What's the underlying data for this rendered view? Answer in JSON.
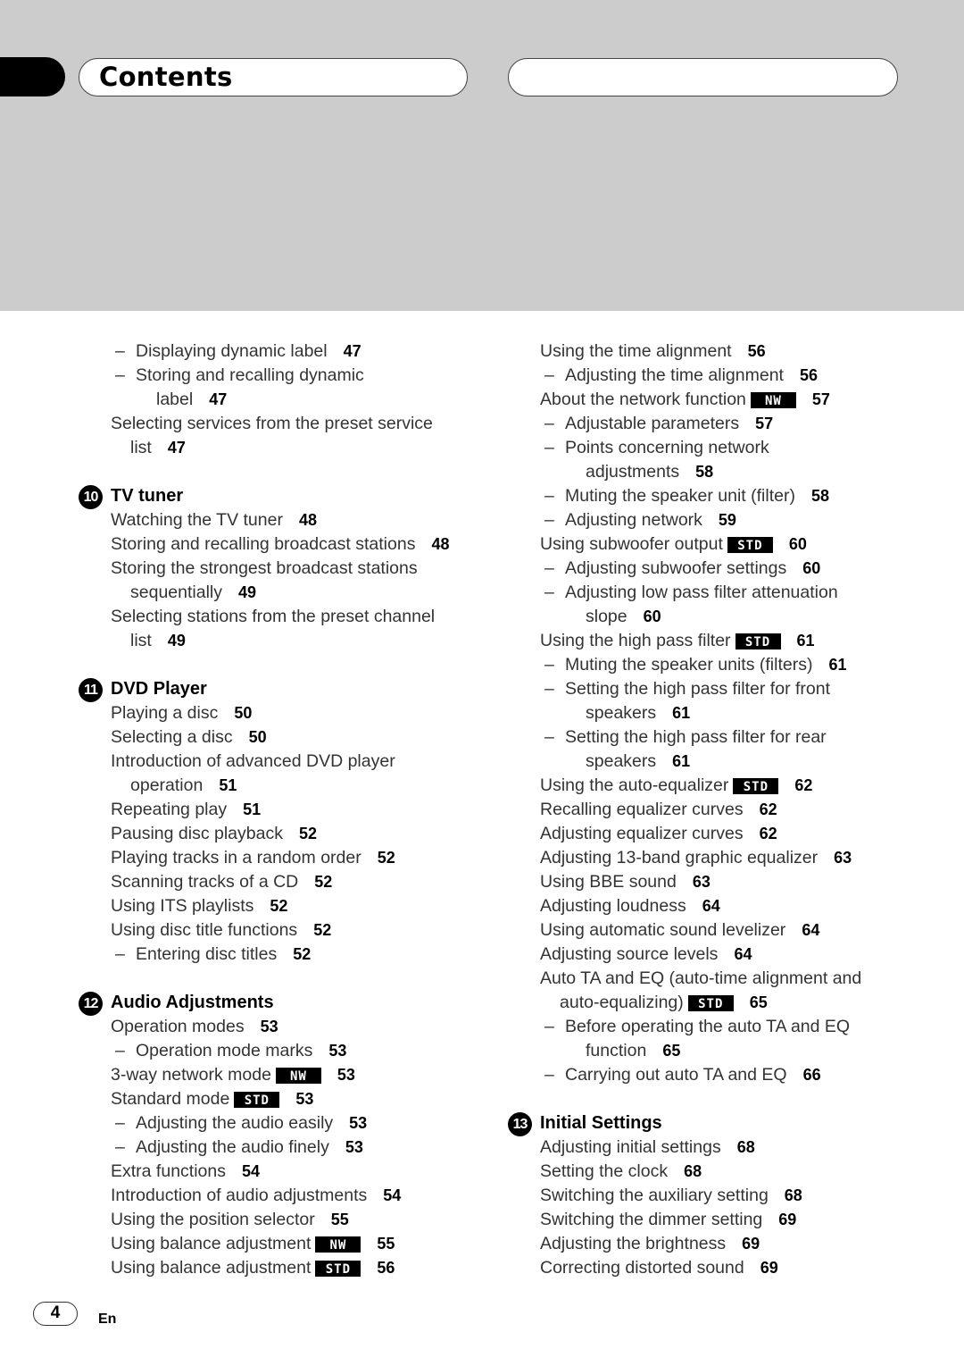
{
  "header": {
    "title": "Contents"
  },
  "left_column": [
    {
      "type": "entry",
      "level": 1,
      "text": "Displaying dynamic label",
      "page": "47"
    },
    {
      "type": "entry",
      "level": 1,
      "text": "Storing and recalling dynamic",
      "page": null
    },
    {
      "type": "cont",
      "level": 1,
      "text": "label",
      "page": "47"
    },
    {
      "type": "entry",
      "level": 0,
      "text": "Selecting services from the preset service",
      "page": null
    },
    {
      "type": "cont",
      "level": 0,
      "text": "list",
      "page": "47"
    },
    {
      "type": "section",
      "number": "10",
      "text": "TV tuner"
    },
    {
      "type": "entry",
      "level": 0,
      "text": "Watching the TV tuner",
      "page": "48"
    },
    {
      "type": "entry",
      "level": 0,
      "text": "Storing and recalling broadcast stations",
      "page": "48"
    },
    {
      "type": "entry",
      "level": 0,
      "text": "Storing the strongest broadcast stations",
      "page": null
    },
    {
      "type": "cont",
      "level": 0,
      "text": "sequentially",
      "page": "49"
    },
    {
      "type": "entry",
      "level": 0,
      "text": "Selecting stations from the preset channel",
      "page": null
    },
    {
      "type": "cont",
      "level": 0,
      "text": "list",
      "page": "49"
    },
    {
      "type": "section",
      "number": "11",
      "text": "DVD Player"
    },
    {
      "type": "entry",
      "level": 0,
      "text": "Playing a disc",
      "page": "50"
    },
    {
      "type": "entry",
      "level": 0,
      "text": "Selecting a disc",
      "page": "50"
    },
    {
      "type": "entry",
      "level": 0,
      "text": "Introduction of advanced DVD player",
      "page": null
    },
    {
      "type": "cont",
      "level": 0,
      "text": "operation",
      "page": "51"
    },
    {
      "type": "entry",
      "level": 0,
      "text": "Repeating play",
      "page": "51"
    },
    {
      "type": "entry",
      "level": 0,
      "text": "Pausing disc playback",
      "page": "52"
    },
    {
      "type": "entry",
      "level": 0,
      "text": "Playing tracks in a random order",
      "page": "52"
    },
    {
      "type": "entry",
      "level": 0,
      "text": "Scanning tracks of a CD",
      "page": "52"
    },
    {
      "type": "entry",
      "level": 0,
      "text": "Using ITS playlists",
      "page": "52"
    },
    {
      "type": "entry",
      "level": 0,
      "text": "Using disc title functions",
      "page": "52"
    },
    {
      "type": "entry",
      "level": 1,
      "text": "Entering disc titles",
      "page": "52"
    },
    {
      "type": "section",
      "number": "12",
      "text": "Audio Adjustments"
    },
    {
      "type": "entry",
      "level": 0,
      "text": "Operation modes",
      "page": "53"
    },
    {
      "type": "entry",
      "level": 1,
      "text": "Operation mode marks",
      "page": "53"
    },
    {
      "type": "entry",
      "level": 0,
      "text": "3-way network mode",
      "badge": "NW",
      "page": "53"
    },
    {
      "type": "entry",
      "level": 0,
      "text": "Standard mode",
      "badge": "STD",
      "page": "53"
    },
    {
      "type": "entry",
      "level": 1,
      "text": "Adjusting the audio easily",
      "page": "53"
    },
    {
      "type": "entry",
      "level": 1,
      "text": "Adjusting the audio finely",
      "page": "53"
    },
    {
      "type": "entry",
      "level": 0,
      "text": "Extra functions",
      "page": "54"
    },
    {
      "type": "entry",
      "level": 0,
      "text": "Introduction of audio adjustments",
      "page": "54"
    },
    {
      "type": "entry",
      "level": 0,
      "text": "Using the position selector",
      "page": "55"
    },
    {
      "type": "entry",
      "level": 0,
      "text": "Using balance adjustment",
      "badge": "NW",
      "page": "55"
    },
    {
      "type": "entry",
      "level": 0,
      "text": "Using balance adjustment",
      "badge": "STD",
      "page": "56"
    }
  ],
  "right_column": [
    {
      "type": "entry",
      "level": 0,
      "text": "Using the time alignment",
      "page": "56"
    },
    {
      "type": "entry",
      "level": 1,
      "text": "Adjusting the time alignment",
      "page": "56"
    },
    {
      "type": "entry",
      "level": 0,
      "text": "About the network function",
      "badge": "NW",
      "page": "57"
    },
    {
      "type": "entry",
      "level": 1,
      "text": "Adjustable parameters",
      "page": "57"
    },
    {
      "type": "entry",
      "level": 1,
      "text": "Points concerning network",
      "page": null
    },
    {
      "type": "cont",
      "level": 1,
      "text": "adjustments",
      "page": "58"
    },
    {
      "type": "entry",
      "level": 1,
      "text": "Muting the speaker unit (filter)",
      "page": "58"
    },
    {
      "type": "entry",
      "level": 1,
      "text": "Adjusting network",
      "page": "59"
    },
    {
      "type": "entry",
      "level": 0,
      "text": "Using subwoofer output",
      "badge": "STD",
      "page": "60"
    },
    {
      "type": "entry",
      "level": 1,
      "text": "Adjusting subwoofer settings",
      "page": "60"
    },
    {
      "type": "entry",
      "level": 1,
      "text": "Adjusting low pass filter attenuation",
      "page": null
    },
    {
      "type": "cont",
      "level": 1,
      "text": "slope",
      "page": "60"
    },
    {
      "type": "entry",
      "level": 0,
      "text": "Using the high pass filter",
      "badge": "STD",
      "page": "61"
    },
    {
      "type": "entry",
      "level": 1,
      "text": "Muting the speaker units (filters)",
      "page": "61"
    },
    {
      "type": "entry",
      "level": 1,
      "text": "Setting the high pass filter for front",
      "page": null
    },
    {
      "type": "cont",
      "level": 1,
      "text": "speakers",
      "page": "61"
    },
    {
      "type": "entry",
      "level": 1,
      "text": "Setting the high pass filter for rear",
      "page": null
    },
    {
      "type": "cont",
      "level": 1,
      "text": "speakers",
      "page": "61"
    },
    {
      "type": "entry",
      "level": 0,
      "text": "Using the auto-equalizer",
      "badge": "STD",
      "page": "62"
    },
    {
      "type": "entry",
      "level": 0,
      "text": "Recalling equalizer curves",
      "page": "62"
    },
    {
      "type": "entry",
      "level": 0,
      "text": "Adjusting equalizer curves",
      "page": "62"
    },
    {
      "type": "entry",
      "level": 0,
      "text": "Adjusting 13-band graphic equalizer",
      "page": "63"
    },
    {
      "type": "entry",
      "level": 0,
      "text": "Using BBE sound",
      "page": "63"
    },
    {
      "type": "entry",
      "level": 0,
      "text": "Adjusting loudness",
      "page": "64"
    },
    {
      "type": "entry",
      "level": 0,
      "text": "Using automatic sound levelizer",
      "page": "64"
    },
    {
      "type": "entry",
      "level": 0,
      "text": "Adjusting source levels",
      "page": "64"
    },
    {
      "type": "entry",
      "level": 0,
      "text": "Auto TA and EQ (auto-time alignment and",
      "page": null
    },
    {
      "type": "cont",
      "level": 0,
      "text": "auto-equalizing)",
      "badge": "STD",
      "page": "65"
    },
    {
      "type": "entry",
      "level": 1,
      "text": "Before operating the auto TA and EQ",
      "page": null
    },
    {
      "type": "cont",
      "level": 1,
      "text": "function",
      "page": "65"
    },
    {
      "type": "entry",
      "level": 1,
      "text": "Carrying out auto TA and EQ",
      "page": "66"
    },
    {
      "type": "section",
      "number": "13",
      "text": "Initial Settings"
    },
    {
      "type": "entry",
      "level": 0,
      "text": "Adjusting initial settings",
      "page": "68"
    },
    {
      "type": "entry",
      "level": 0,
      "text": "Setting the clock",
      "page": "68"
    },
    {
      "type": "entry",
      "level": 0,
      "text": "Switching the auxiliary setting",
      "page": "68"
    },
    {
      "type": "entry",
      "level": 0,
      "text": "Switching the dimmer setting",
      "page": "69"
    },
    {
      "type": "entry",
      "level": 0,
      "text": "Adjusting the brightness",
      "page": "69"
    },
    {
      "type": "entry",
      "level": 0,
      "text": "Correcting distorted sound",
      "page": "69"
    }
  ],
  "dash_glyph": "–",
  "footer": {
    "page_number": "4",
    "language": "En"
  },
  "colors": {
    "header_bg": "#cccccc",
    "badge_bg": "#000000",
    "text": "#333333"
  }
}
